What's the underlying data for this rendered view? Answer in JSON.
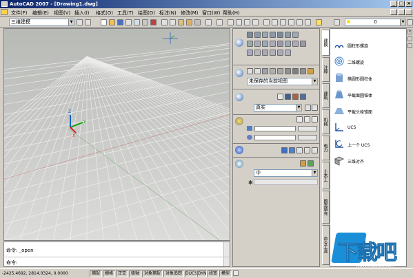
{
  "window": {
    "title": "AutoCAD 2007 - [Drawing1.dwg]",
    "min": "_",
    "restore": "□",
    "close": "×"
  },
  "menu": [
    "文件(F)",
    "编辑(E)",
    "视图(V)",
    "插入(I)",
    "格式(O)",
    "工具(T)",
    "绘图(D)",
    "标注(N)",
    "修改(M)",
    "窗口(W)",
    "帮助(H)"
  ],
  "toolbar": {
    "workspace": "三维建模",
    "layer_value": "0"
  },
  "command": {
    "line1": "命令: _open",
    "line2": "命令:"
  },
  "status": {
    "coords": "-2425.4692, 2814.0324, 0.0000",
    "buttons": [
      "捕捉",
      "栅格",
      "正交",
      "极轴",
      "对象捕捉",
      "对象追踪",
      "DUCS",
      "DYN",
      "线宽",
      "模型"
    ]
  },
  "dashboard": {
    "view": "未保存的当前视图",
    "visual_style": "真实",
    "material_value": "中"
  },
  "palette": {
    "tabs": [
      "建模",
      "注释",
      "建筑",
      "机械",
      "电力",
      "土木工",
      "图案填充",
      "命令工具"
    ],
    "tools": [
      "圆柱形螺旋",
      "二维螺旋",
      "椭圆形圆柱体",
      "平截面圆锥体",
      "平截头棱锥面",
      "UCS",
      "上一个 UCS",
      "三维对齐"
    ]
  },
  "watermark": {
    "text": "下载吧",
    "url": "www.xiazaiba.com"
  }
}
